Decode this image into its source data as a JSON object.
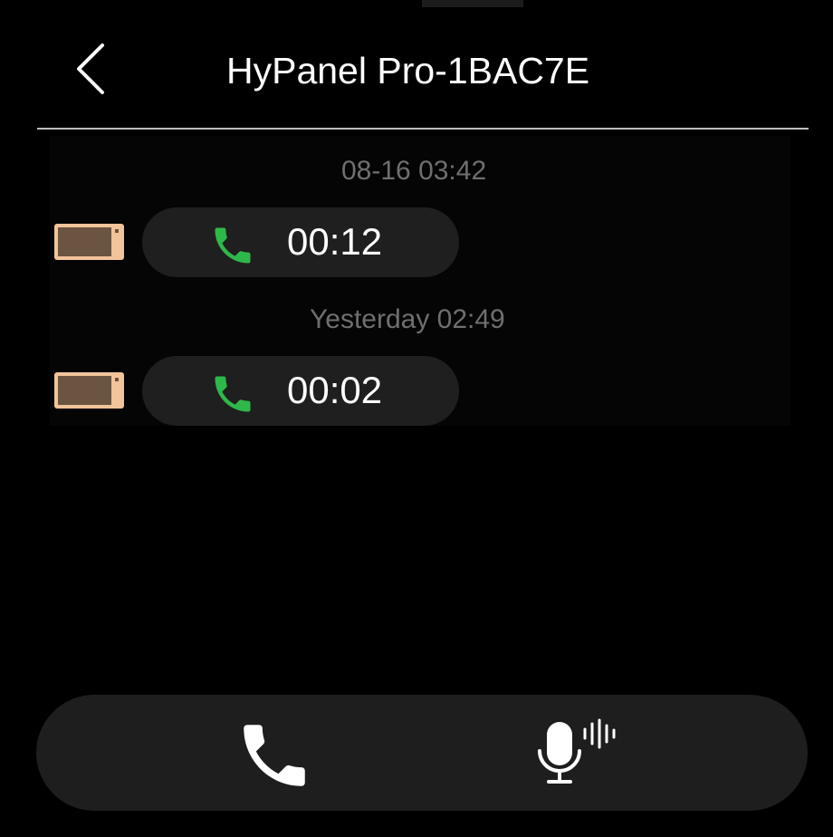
{
  "header": {
    "title": "HyPanel Pro-1BAC7E",
    "back_icon": "chevron-left-icon"
  },
  "history": {
    "entries": [
      {
        "timestamp": "08-16 03:42",
        "device_icon": "tablet-device-icon",
        "call_icon": "phone-icon",
        "duration": "00:12"
      },
      {
        "timestamp": "Yesterday 02:49",
        "device_icon": "tablet-device-icon",
        "call_icon": "phone-icon",
        "duration": "00:02"
      }
    ]
  },
  "bottom_bar": {
    "call_icon": "phone-icon",
    "voice_icon": "microphone-voice-icon"
  },
  "colors": {
    "background": "#000000",
    "bubble": "#1f1f1f",
    "bar": "#1e1e1e",
    "call_green": "#2fb84a",
    "timestamp_gray": "#6f6f6f",
    "device_tan": "#f2c49a",
    "device_brown": "#6b5440"
  }
}
